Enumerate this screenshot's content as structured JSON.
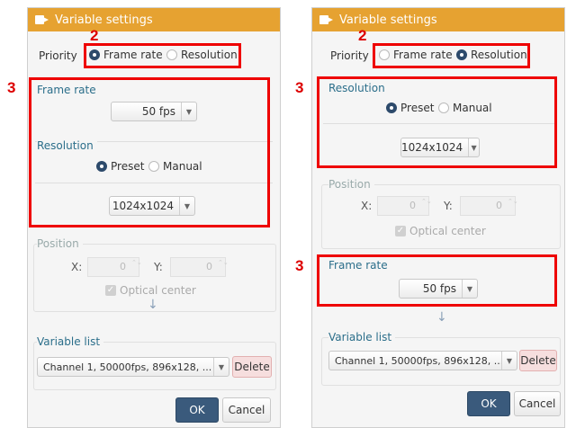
{
  "left": {
    "title": "Variable settings",
    "priority_label": "Priority",
    "priority_options": [
      "Frame rate",
      "Resolution"
    ],
    "priority_selected": "Frame rate",
    "frame_rate": {
      "title": "Frame rate",
      "value": "50 fps"
    },
    "resolution": {
      "title": "Resolution",
      "options": [
        "Preset",
        "Manual"
      ],
      "selected": "Preset",
      "value": "1024x1024"
    },
    "position": {
      "title": "Position",
      "x_label": "X:",
      "x_value": "0",
      "y_label": "Y:",
      "y_value": "0",
      "optical_center": "Optical center"
    },
    "variable_list": {
      "title": "Variable list",
      "value": "Channel 1, 50000fps, 896x128, ...",
      "delete_label": "Delete"
    },
    "ok_label": "OK",
    "cancel_label": "Cancel"
  },
  "right": {
    "title": "Variable settings",
    "priority_label": "Priority",
    "priority_options": [
      "Frame rate",
      "Resolution"
    ],
    "priority_selected": "Resolution",
    "resolution": {
      "title": "Resolution",
      "options": [
        "Preset",
        "Manual"
      ],
      "selected": "Preset",
      "value": "1024x1024"
    },
    "position": {
      "title": "Position",
      "x_label": "X:",
      "x_value": "0",
      "y_label": "Y:",
      "y_value": "0",
      "optical_center": "Optical center"
    },
    "frame_rate": {
      "title": "Frame rate",
      "value": "50 fps"
    },
    "variable_list": {
      "title": "Variable list",
      "value": "Channel 1, 50000fps, 896x128, ...",
      "delete_label": "Delete"
    },
    "ok_label": "OK",
    "cancel_label": "Cancel"
  },
  "annotations": {
    "two": "2",
    "three": "3"
  },
  "colors": {
    "titlebar": "#e6a231",
    "highlight": "#ee0000",
    "section_title": "#2b6e8a",
    "ok_button": "#3a5a7c",
    "delete_button": "#f6dede"
  }
}
